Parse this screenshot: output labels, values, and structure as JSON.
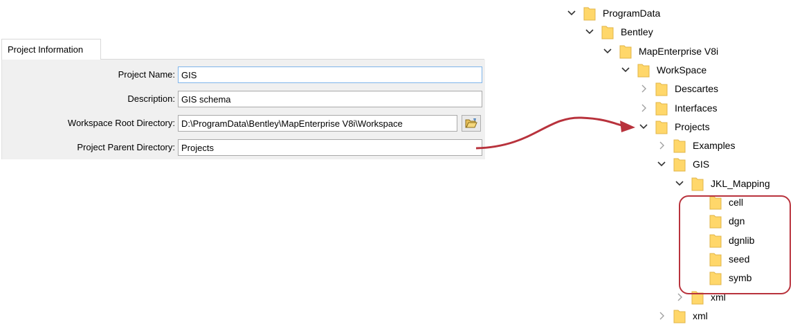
{
  "form": {
    "tab_label": "Project Information",
    "fields": [
      {
        "label": "Project Name:",
        "value": "GIS"
      },
      {
        "label": "Description:",
        "value": "GIS schema"
      },
      {
        "label": "Workspace Root Directory:",
        "value": "D:\\ProgramData\\Bentley\\MapEnterprise V8i\\Workspace"
      },
      {
        "label": "Project Parent Directory:",
        "value": "Projects"
      }
    ],
    "browse_icon": "open-folder-icon"
  },
  "colors": {
    "arrow": "#b8323c",
    "highlight_box": "#b8323c",
    "folder_fill": "#ffd76a",
    "panel_bg": "#f0f0f0"
  },
  "tree": {
    "items": [
      {
        "label": "ProgramData",
        "expanded": true
      },
      {
        "label": "Bentley",
        "expanded": true
      },
      {
        "label": "MapEnterprise V8i",
        "expanded": true
      },
      {
        "label": "WorkSpace",
        "expanded": true
      },
      {
        "label": "Descartes",
        "expanded": false
      },
      {
        "label": "Interfaces",
        "expanded": false
      },
      {
        "label": "Projects",
        "expanded": true
      },
      {
        "label": "Examples",
        "expanded": false
      },
      {
        "label": "GIS",
        "expanded": true
      },
      {
        "label": "JKL_Mapping",
        "expanded": true
      },
      {
        "label": "cell",
        "expanded": null
      },
      {
        "label": "dgn",
        "expanded": null
      },
      {
        "label": "dgnlib",
        "expanded": null
      },
      {
        "label": "seed",
        "expanded": null
      },
      {
        "label": "symb",
        "expanded": null
      },
      {
        "label": "xml",
        "expanded": false
      },
      {
        "label": "xml",
        "expanded": false
      }
    ]
  }
}
